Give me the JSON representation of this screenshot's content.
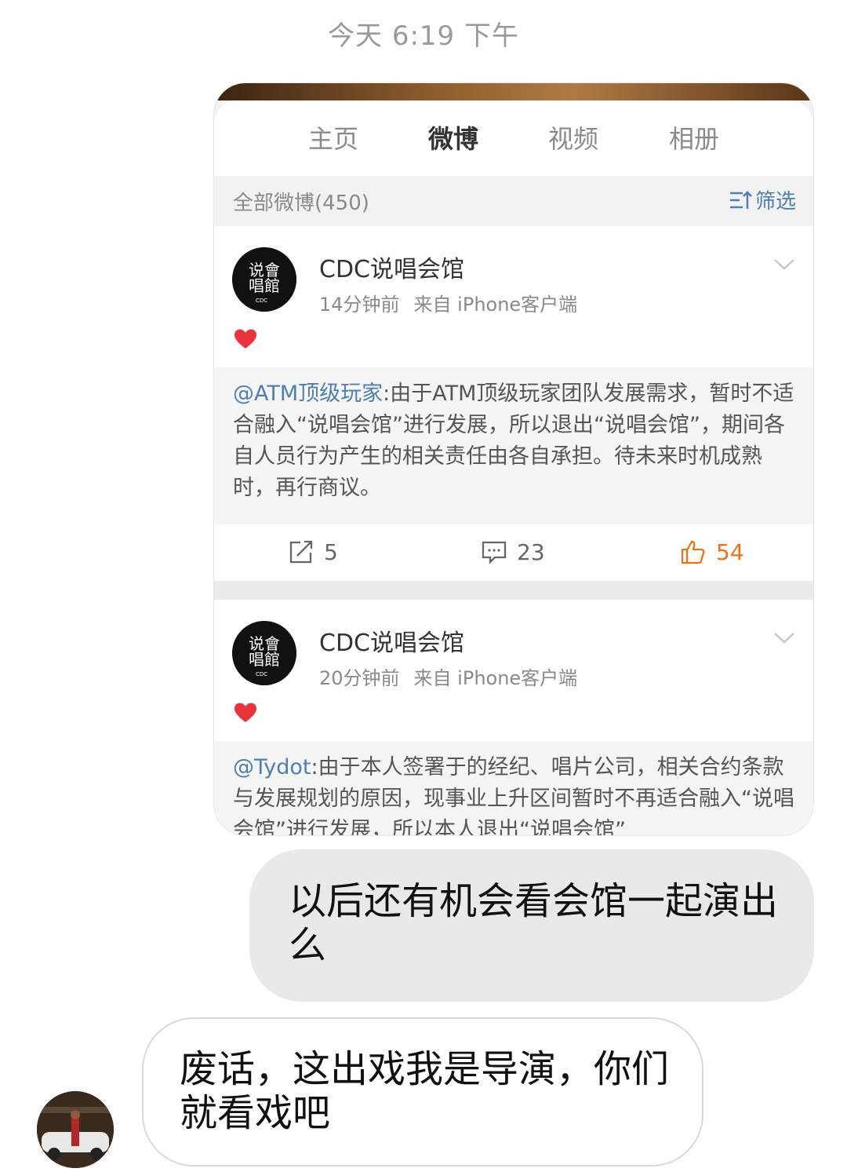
{
  "timestamp": "今天 6:19 下午",
  "profile": {
    "tabs": [
      {
        "label": "主页",
        "active": false
      },
      {
        "label": "微博",
        "active": true
      },
      {
        "label": "视频",
        "active": false
      },
      {
        "label": "相册",
        "active": false
      }
    ],
    "filter_count": "全部微博(450)",
    "filter_label": "筛选",
    "accent_color": "#f08a1c",
    "link_color": "#4e7fb0"
  },
  "posts": [
    {
      "author": "CDC说唱会馆",
      "time": "14分钟前",
      "source": "来自 iPhone客户端",
      "mention": "@ATM顶级玩家",
      "text": ":由于ATM顶级玩家团队发展需求，暂时不适合融入“说唱会馆”进行发展，所以退出“说唱会馆”，期间各自人员行为产生的相关责任由各自承担。待未来时机成熟时，再行商议。",
      "reposts": "5",
      "comments": "23",
      "likes": "54"
    },
    {
      "author": "CDC说唱会馆",
      "time": "20分钟前",
      "source": "来自 iPhone客户端",
      "mention": "@Tydot",
      "text": ":由于本人签署于的经纪、唱片公司，相关合约条款与发展规划的原因，现事业上升区间暂时不再适合融入“说唱会馆”进行发展，所以本人退出“说唱会馆”"
    }
  ],
  "messages": {
    "outgoing": "以后还有机会看会馆一起演出么",
    "incoming": "废话，这出戏我是导演，你们就看戏吧"
  }
}
